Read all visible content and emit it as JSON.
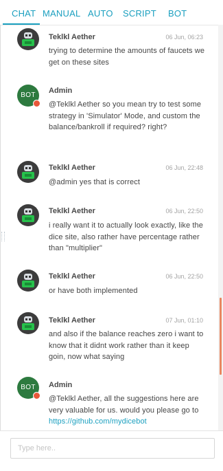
{
  "tabs": [
    "CHAT",
    "MANUAL",
    "AUTO",
    "SCRIPT",
    "BOT"
  ],
  "bot_avatar_label": "BOT",
  "messages": [
    {
      "name": "Teklkl Aether",
      "time": "06 Jun, 06:23",
      "avatar": "robot",
      "text": "trying to determine the amounts of faucets we get on these sites"
    },
    {
      "name": "Admin",
      "time": "",
      "avatar": "bot",
      "text": "@Teklkl Aether so you mean try to test some strategy in 'Simulator' Mode, and custom the balance/bankroll if required? right?"
    },
    {
      "name": "Teklkl Aether",
      "time": "06 Jun, 22:48",
      "avatar": "robot",
      "text": "@admin yes that is correct"
    },
    {
      "name": "Teklkl Aether",
      "time": "06 Jun, 22:50",
      "avatar": "robot",
      "text": "i really want it to actually look exactly, like the dice site, also rather have percentage rather than \"multiplier\""
    },
    {
      "name": "Teklkl Aether",
      "time": "06 Jun, 22:50",
      "avatar": "robot",
      "text": "or have both implemented"
    },
    {
      "name": "Teklkl Aether",
      "time": "07 Jun, 01:10",
      "avatar": "robot",
      "text": "and also if the balance reaches zero i want to know that it didnt work rather than it keep goin, now what saying"
    },
    {
      "name": "Admin",
      "time": "",
      "avatar": "bot",
      "text": "@Teklkl Aether, all the suggestions here are very valuable for us. would you please go to ",
      "link": "https://github.com/mydicebot"
    }
  ],
  "input": {
    "placeholder": "Type here.."
  },
  "colors": {
    "accent": "#1a9fbf",
    "bot_avatar": "#2d7a3f",
    "status_dot": "#e8573a",
    "scroll_thumb": "#e8865f"
  }
}
